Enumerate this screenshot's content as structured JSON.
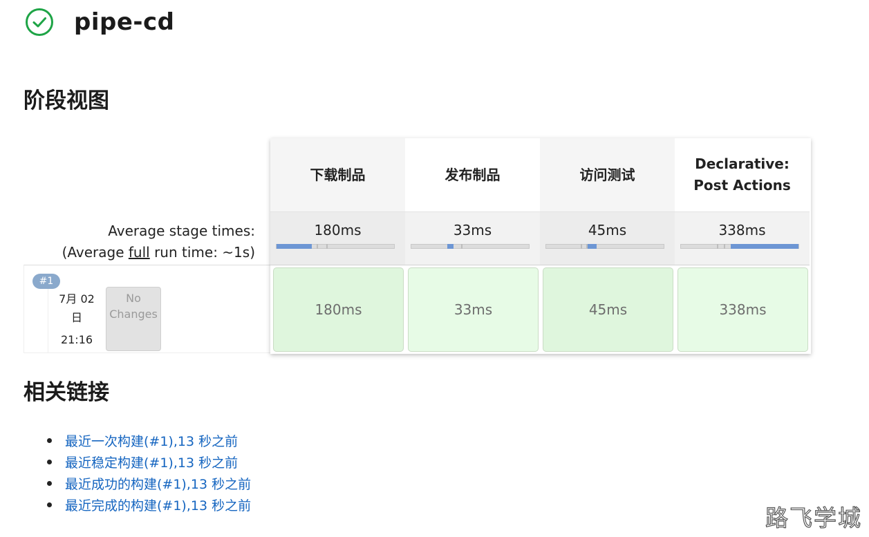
{
  "header": {
    "title": "pipe-cd",
    "status_icon": "check-circle-icon",
    "status_color": "#1ea446"
  },
  "stage_view": {
    "heading": "阶段视图",
    "average_label": "Average stage times:",
    "average_run_prefix": "(Average ",
    "average_run_link": "full",
    "average_run_suffix": " run time: ~1s)",
    "stages": [
      {
        "name": "下载制品",
        "avg": "180ms",
        "fill": 0.3,
        "cell": "180ms"
      },
      {
        "name": "发布制品",
        "avg": "33ms",
        "fill": 0.055,
        "cell": "33ms"
      },
      {
        "name": "访问测试",
        "avg": "45ms",
        "fill": 0.075,
        "cell": "45ms"
      },
      {
        "name": "Declarative: Post Actions",
        "avg": "338ms",
        "fill": 0.58,
        "cell": "338ms"
      }
    ],
    "run": {
      "badge": "#1",
      "date_line1": "7月 02",
      "date_line2": "日",
      "time": "21:16",
      "changes_line1": "No",
      "changes_line2": "Changes"
    }
  },
  "links": {
    "heading": "相关链接",
    "items": [
      "最近一次构建(#1),13 秒之前",
      "最近稳定构建(#1),13 秒之前",
      "最近成功的构建(#1),13 秒之前",
      "最近完成的构建(#1),13 秒之前"
    ]
  },
  "watermark": "路飞学城"
}
